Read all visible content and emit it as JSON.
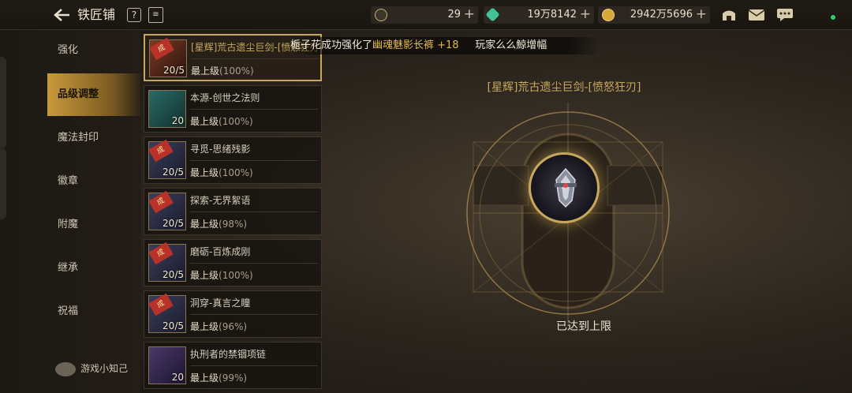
{
  "header": {
    "title": "铁匠铺",
    "help_icon": "question-icon",
    "book_icon": "book-icon",
    "currencies": [
      {
        "icon": "coin-c-icon",
        "value": "29",
        "color": "#c7b27a"
      },
      {
        "icon": "green-gem-icon",
        "value": "19万8142",
        "color": "#3fc49a"
      },
      {
        "icon": "gold-coin-icon",
        "value": "2942万5696",
        "color": "#d6a93a"
      }
    ],
    "icons": [
      "shop-icon",
      "mail-icon",
      "chat-icon"
    ]
  },
  "sidebar": {
    "items": [
      {
        "label": "强化"
      },
      {
        "label": "品级调整"
      },
      {
        "label": "魔法封印"
      },
      {
        "label": "徽章"
      },
      {
        "label": "附魔"
      },
      {
        "label": "继承"
      },
      {
        "label": "祝福"
      }
    ],
    "active_index": 1,
    "tips_label": "游戏小知己"
  },
  "items": [
    {
      "name": "[星辉]荒古遗尘巨剑-[愤怒狂刃]",
      "grade": "最上级",
      "pct": "(100%)",
      "level": "20/5",
      "tag": "成",
      "selected": true
    },
    {
      "name": "本源-创世之法则",
      "grade": "最上级",
      "pct": "(100%)",
      "level": "20",
      "tag": "",
      "selected": false
    },
    {
      "name": "寻觅-思绪残影",
      "grade": "最上级",
      "pct": "(100%)",
      "level": "20/5",
      "tag": "成",
      "selected": false
    },
    {
      "name": "探索-无界絮语",
      "grade": "最上级",
      "pct": "(98%)",
      "level": "20/5",
      "tag": "成",
      "selected": false
    },
    {
      "name": "磨砺-百炼成刚",
      "grade": "最上级",
      "pct": "(100%)",
      "level": "20/5",
      "tag": "成",
      "selected": false
    },
    {
      "name": "洞穿-真言之瞳",
      "grade": "最上级",
      "pct": "(96%)",
      "level": "20/5",
      "tag": "成",
      "selected": false
    },
    {
      "name": "执刑者的禁锢项链",
      "grade": "最上级",
      "pct": "(99%)",
      "level": "20",
      "tag": "",
      "selected": false
    }
  ],
  "notice": {
    "prefix": "栀子花成功强化了",
    "item": "幽魂魅影长裤 +18",
    "suffix": "玩家么么鯨增幅"
  },
  "detail": {
    "title": "[星辉]荒古遗尘巨剑-[愤怒狂刃]",
    "status": "已达到上限"
  }
}
